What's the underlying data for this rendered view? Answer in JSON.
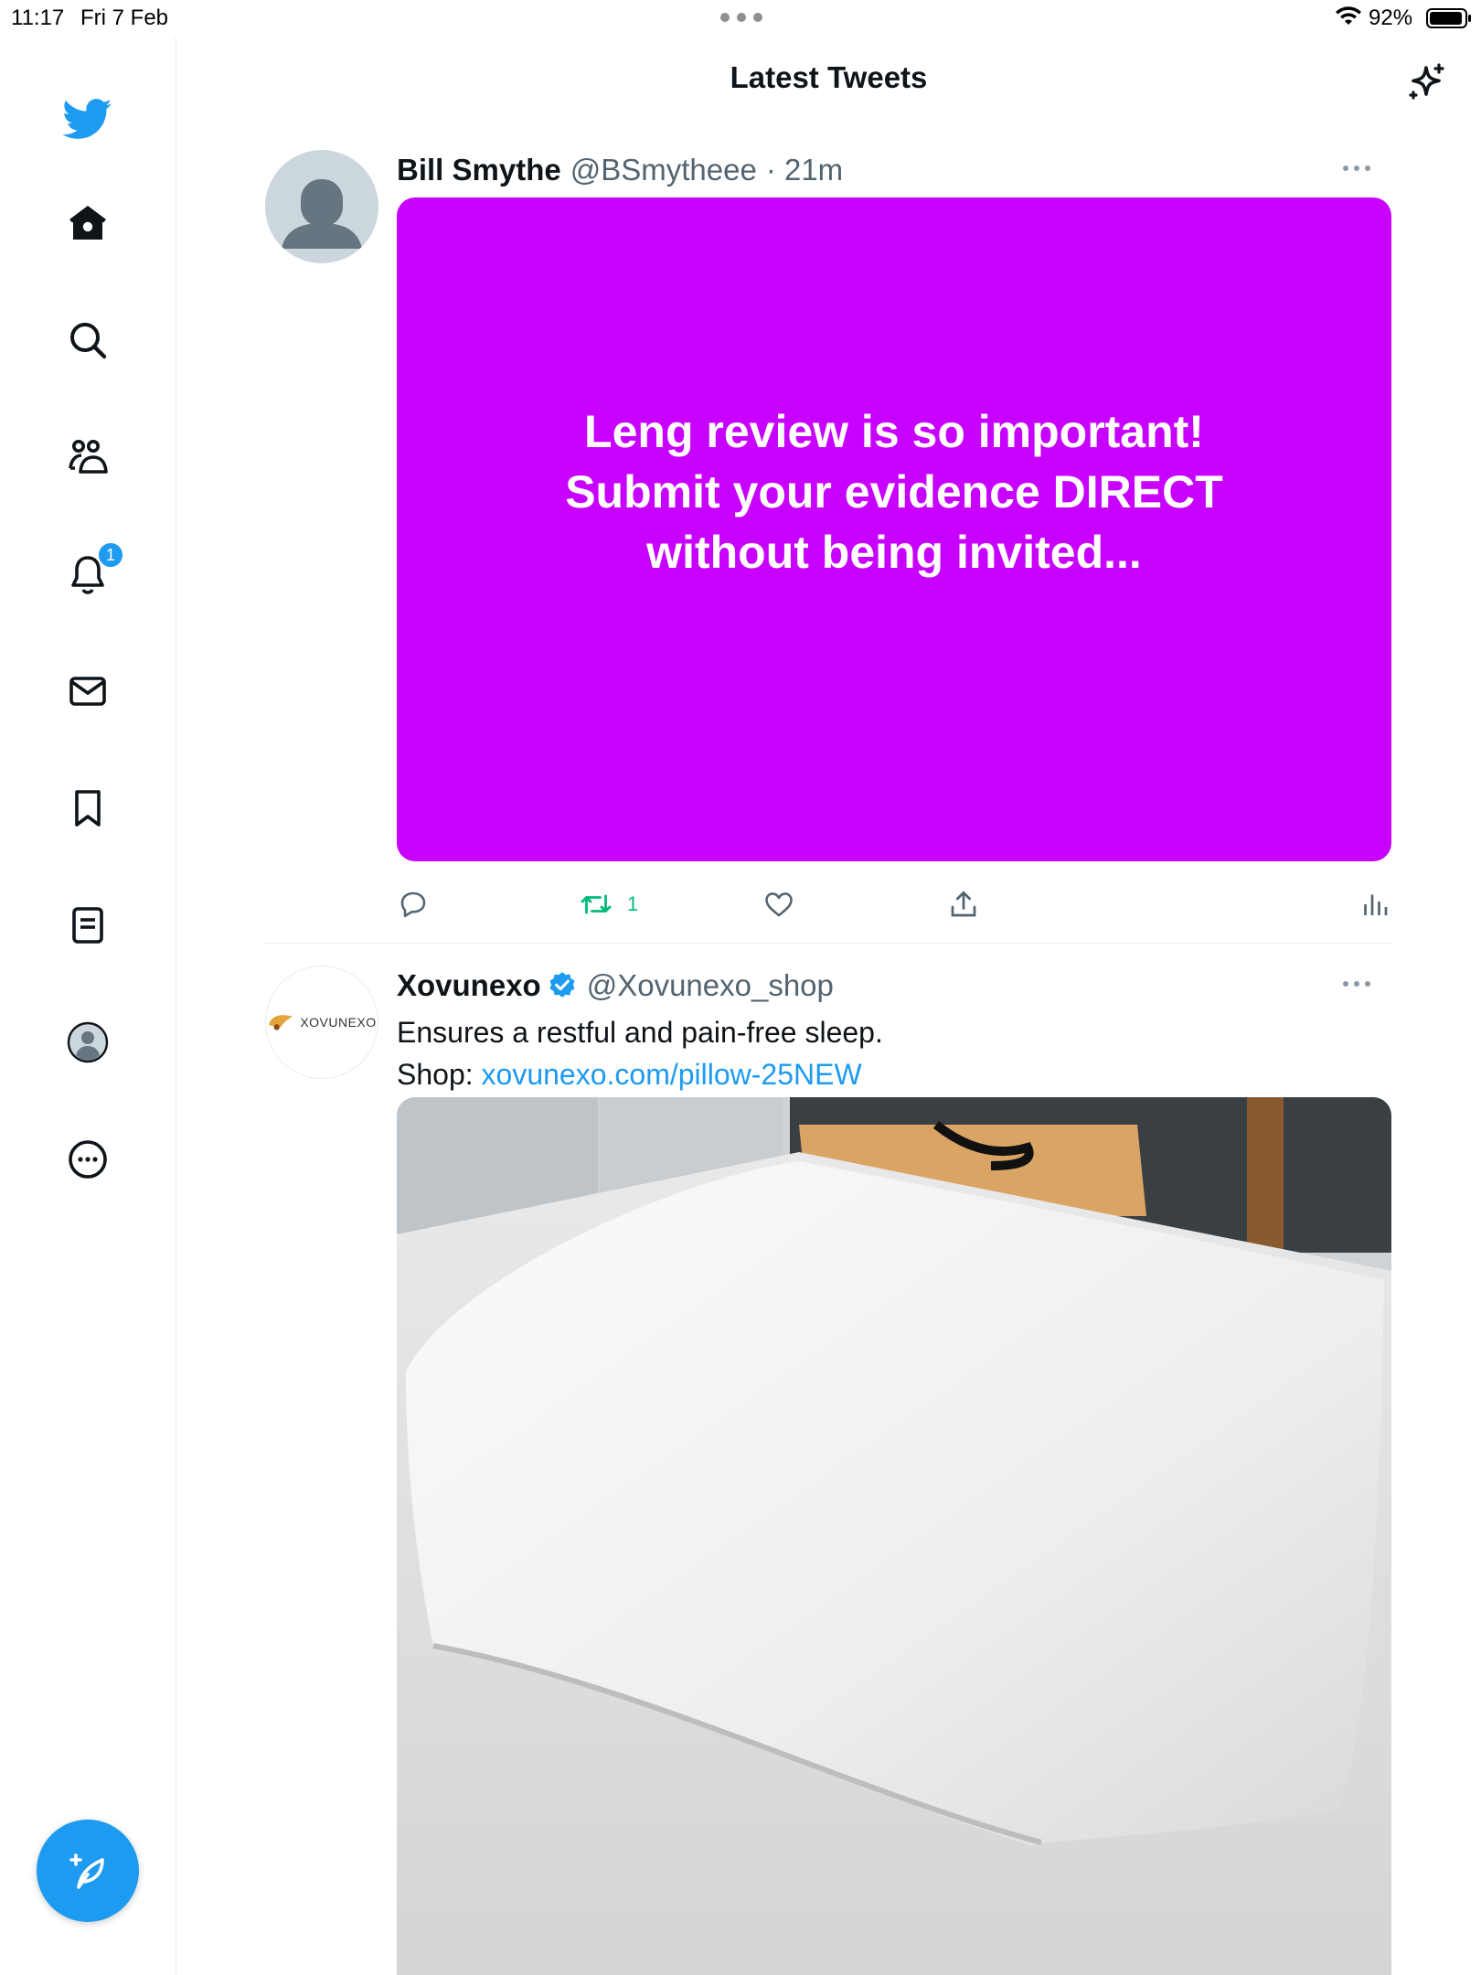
{
  "status_bar": {
    "time": "11:17",
    "date": "Fri 7 Feb",
    "battery": "92%"
  },
  "sidebar": {
    "items": [
      {
        "name": "home",
        "icon": "home-icon"
      },
      {
        "name": "explore",
        "icon": "search-icon"
      },
      {
        "name": "communities",
        "icon": "people-icon"
      },
      {
        "name": "notifications",
        "icon": "bell-icon",
        "badge": "1"
      },
      {
        "name": "messages",
        "icon": "mail-icon"
      },
      {
        "name": "bookmarks",
        "icon": "bookmark-icon"
      },
      {
        "name": "lists",
        "icon": "list-icon"
      },
      {
        "name": "profile",
        "icon": "avatar-icon"
      },
      {
        "name": "more",
        "icon": "more-circle-icon"
      }
    ]
  },
  "header": {
    "title": "Latest Tweets"
  },
  "tweets": [
    {
      "name": "Bill Smythe",
      "handle": "@BSmytheee",
      "time": "· 21m",
      "image_text": [
        "Leng review is so important!",
        "Submit your evidence DIRECT",
        "without being invited..."
      ],
      "retweet_count": "1"
    },
    {
      "name": "Xovunexo",
      "handle": "@Xovunexo_shop",
      "avatar_text": "XOVUNEXO",
      "body_line1": "Ensures a restful and pain-free sleep.",
      "body_line2_prefix": "Shop: ",
      "body_link": "xovunexo.com/pillow-25NEW"
    }
  ],
  "colors": {
    "brand": "#1d9bf0",
    "promo_bg": "#c700ff",
    "retweet": "#00ba7c"
  }
}
